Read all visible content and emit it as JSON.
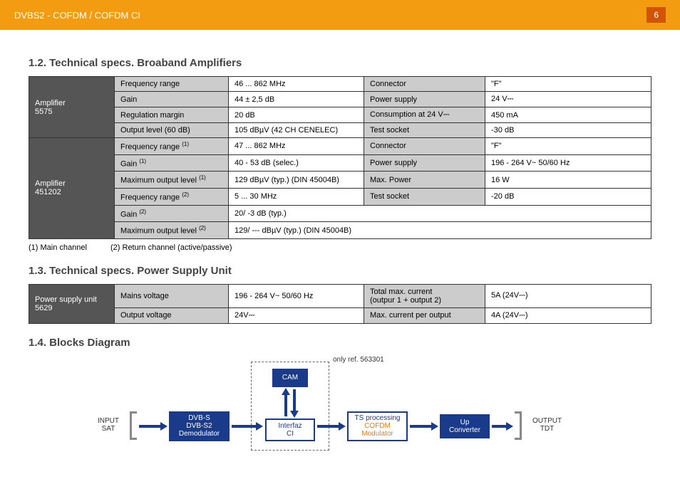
{
  "header": {
    "title": "DVBS2 - COFDM / COFDM CI",
    "page": "6"
  },
  "s12": {
    "heading": "1.2.  Technical specs. Broaband Amplifiers",
    "amp1": {
      "name": "Amplifier\n5575",
      "r1l": "Frequency range",
      "r1v": "46 ... 862 MHz",
      "r1l2": "Connector",
      "r1v2": "\"F\"",
      "r2l": "Gain",
      "r2v": "44 ± 2,5 dB",
      "r2l2": "Power supply",
      "r2v2": "24 V⎓",
      "r3l": "Regulation margin",
      "r3v": "20 dB",
      "r3l2": "Consumption at 24 V⎓",
      "r3v2": "450 mA",
      "r4l": "Output level (60 dB)",
      "r4v": "105 dBµV (42 CH CENELEC)",
      "r4l2": "Test socket",
      "r4v2": "-30 dB"
    },
    "amp2": {
      "name": "Amplifier\n451202",
      "r1l": "Frequency range",
      "r1v": "47 ... 862 MHz",
      "r1l2": "Connector",
      "r1v2": "\"F\"",
      "r2l": "Gain",
      "r2v": "40 - 53 dB (selec.)",
      "r2l2": "Power supply",
      "r2v2": "196 - 264 V~  50/60 Hz",
      "r3l": "Maximum output level",
      "r3v": "129 dBµV (typ.) (DIN 45004B)",
      "r3l2": "Max. Power",
      "r3v2": "16 W",
      "r4l": "Frequency range",
      "r4v": "5 ... 30 MHz",
      "r4l2": "Test socket",
      "r4v2": "-20 dB",
      "r5l": "Gain",
      "r5v": "20/ -3 dB (typ.)",
      "r6l": "Maximum output level",
      "r6v": "129/ ---  dBµV (typ.) (DIN 45004B)"
    },
    "foot1": "(1) Main channel",
    "foot2": "(2) Return channel (active/passive)"
  },
  "s13": {
    "heading": "1.3.  Technical specs. Power Supply Unit",
    "psu": {
      "name": "Power supply unit\n5629",
      "r1l": "Mains voltage",
      "r1v": "196 - 264 V~  50/60 Hz",
      "r1l2": "Total max. current\n(outpur 1 + output 2)",
      "r1v2": "5A    (24V⎓)",
      "r2l": "Output voltage",
      "r2v": "24V⎓",
      "r2l2": "Max. current per output",
      "r2v2": "4A    (24V⎓)"
    }
  },
  "s14": {
    "heading": "1.4.  Blocks Diagram",
    "note": "only ref. 563301",
    "input": "INPUT\nSAT",
    "output": "OUTPUT\nTDT",
    "b1": "DVB-S\nDVB-S2\nDemodulator",
    "b2": "Interfaz\nCI",
    "b3a": "TS processing",
    "b3b": "COFDM\nModulator",
    "b4": "Up\nConverter",
    "cam": "CAM"
  }
}
